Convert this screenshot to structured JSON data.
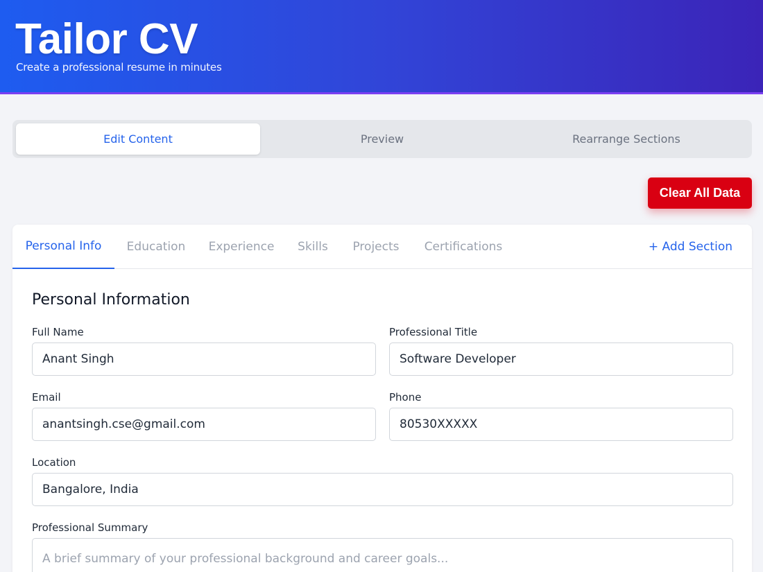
{
  "header": {
    "title": "Tailor CV",
    "subtitle": "Create a professional resume in minutes"
  },
  "mode_tabs": [
    {
      "label": "Edit Content",
      "active": true
    },
    {
      "label": "Preview",
      "active": false
    },
    {
      "label": "Rearrange Sections",
      "active": false
    }
  ],
  "actions": {
    "clear_all": "Clear All Data"
  },
  "section_tabs": [
    {
      "label": "Personal Info",
      "active": true
    },
    {
      "label": "Education",
      "active": false
    },
    {
      "label": "Experience",
      "active": false
    },
    {
      "label": "Skills",
      "active": false
    },
    {
      "label": "Projects",
      "active": false
    },
    {
      "label": "Certifications",
      "active": false
    }
  ],
  "add_section": "+ Add Section",
  "personal": {
    "heading": "Personal Information",
    "full_name": {
      "label": "Full Name",
      "value": "Anant Singh"
    },
    "title": {
      "label": "Professional Title",
      "value": "Software Developer"
    },
    "email": {
      "label": "Email",
      "value": "anantsingh.cse@gmail.com"
    },
    "phone": {
      "label": "Phone",
      "value": "80530XXXXX"
    },
    "location": {
      "label": "Location",
      "value": "Bangalore, India"
    },
    "summary": {
      "label": "Professional Summary",
      "value": "",
      "placeholder": "A brief summary of your professional background and career goals..."
    }
  },
  "colors": {
    "accent": "#2563eb",
    "danger": "#d90012",
    "header_start": "#1e5cf0",
    "header_end": "#3b24b8"
  }
}
